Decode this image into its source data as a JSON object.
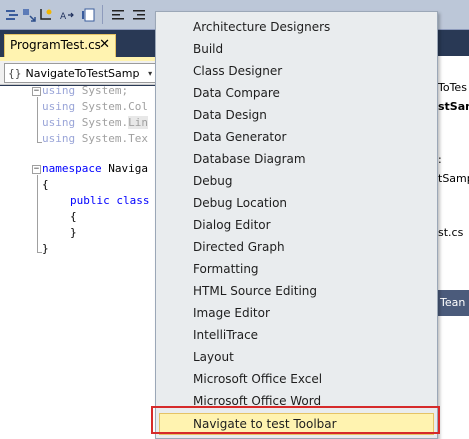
{
  "toolbar": {
    "buttons": [
      {
        "icon": "indent-icon"
      },
      {
        "icon": "move-icon"
      },
      {
        "icon": "step-icon"
      },
      {
        "icon": "format-icon"
      },
      {
        "icon": "document-icon"
      },
      {
        "icon": "comment-icon"
      },
      {
        "icon": "uncomment-icon"
      },
      {
        "icon": "bookmark-icon"
      }
    ]
  },
  "document": {
    "tab_label": "ProgramTest.cs",
    "close_glyph": "✕",
    "nav_combo_text": "NavigateToTestSamp",
    "nav_combo_arrow": "▾"
  },
  "code": {
    "lines": [
      {
        "kw": "using",
        "rest": " System;"
      },
      {
        "kw": "using",
        "rest": " System.Col"
      },
      {
        "kw": "using",
        "rest": " System.",
        "highlight": "Lin"
      },
      {
        "kw": "using",
        "rest": " System.Tex"
      },
      {
        "kw": "namespace",
        "rest": " Naviga"
      },
      {
        "text": "{"
      },
      {
        "kw": "public",
        "rest": " class"
      },
      {
        "text": "{"
      },
      {
        "text": "}"
      },
      {
        "text": "}"
      }
    ]
  },
  "right_panel": {
    "line1": "ToTes",
    "line2": "stSam",
    "line3": ":",
    "line4": "tSamp",
    "line5": "st.cs",
    "team_label": "Tean"
  },
  "menu": {
    "items": [
      {
        "label": "Architecture Designers"
      },
      {
        "label": "Build"
      },
      {
        "label": "Class Designer"
      },
      {
        "label": "Data Compare"
      },
      {
        "label": "Data Design"
      },
      {
        "label": "Data Generator"
      },
      {
        "label": "Database Diagram"
      },
      {
        "label": "Debug"
      },
      {
        "label": "Debug Location"
      },
      {
        "label": "Dialog Editor"
      },
      {
        "label": "Directed Graph"
      },
      {
        "label": "Formatting"
      },
      {
        "label": "HTML Source Editing"
      },
      {
        "label": "Image Editor"
      },
      {
        "label": "IntelliTrace"
      },
      {
        "label": "Layout"
      },
      {
        "label": "Microsoft Office Excel"
      },
      {
        "label": "Microsoft Office Word"
      },
      {
        "label": "Navigate to test Toolbar",
        "selected": true
      }
    ]
  },
  "colors": {
    "accent_highlight": "#fff3b0",
    "annotation_red": "#d62a2a",
    "keyword_blue": "#0000ff"
  }
}
